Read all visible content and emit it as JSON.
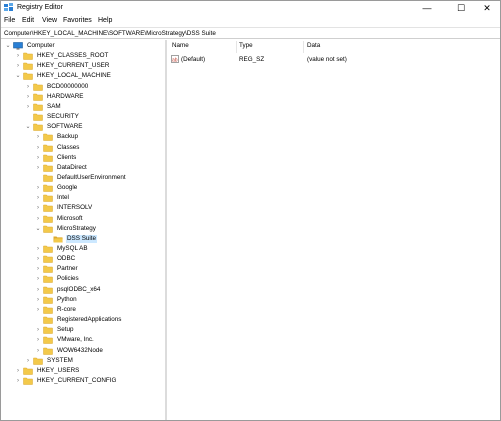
{
  "window": {
    "title": "Registry Editor"
  },
  "title_buttons": {
    "minimize": "—",
    "maximize": "☐",
    "close": "✕"
  },
  "menu": [
    "File",
    "Edit",
    "View",
    "Favorites",
    "Help"
  ],
  "address": "Computer\\HKEY_LOCAL_MACHINE\\SOFTWARE\\MicroStrategy\\DSS Suite",
  "tree": [
    {
      "label": "Computer",
      "level": 0,
      "expander": "⌄",
      "icon": "computer-icon"
    },
    {
      "label": "HKEY_CLASSES_ROOT",
      "level": 1,
      "expander": "›",
      "icon": "folder-icon"
    },
    {
      "label": "HKEY_CURRENT_USER",
      "level": 1,
      "expander": "›",
      "icon": "folder-icon"
    },
    {
      "label": "HKEY_LOCAL_MACHINE",
      "level": 1,
      "expander": "⌄",
      "icon": "folder-icon"
    },
    {
      "label": "BCD00000000",
      "level": 2,
      "expander": "›",
      "icon": "folder-icon"
    },
    {
      "label": "HARDWARE",
      "level": 2,
      "expander": "›",
      "icon": "folder-icon"
    },
    {
      "label": "SAM",
      "level": 2,
      "expander": "›",
      "icon": "folder-icon"
    },
    {
      "label": "SECURITY",
      "level": 2,
      "expander": "",
      "icon": "folder-icon"
    },
    {
      "label": "SOFTWARE",
      "level": 2,
      "expander": "⌄",
      "icon": "folder-icon"
    },
    {
      "label": "Backup",
      "level": 3,
      "expander": "›",
      "icon": "folder-icon"
    },
    {
      "label": "Classes",
      "level": 3,
      "expander": "›",
      "icon": "folder-icon"
    },
    {
      "label": "Clients",
      "level": 3,
      "expander": "›",
      "icon": "folder-icon"
    },
    {
      "label": "DataDirect",
      "level": 3,
      "expander": "›",
      "icon": "folder-icon"
    },
    {
      "label": "DefaultUserEnvironment",
      "level": 3,
      "expander": "",
      "icon": "folder-icon"
    },
    {
      "label": "Google",
      "level": 3,
      "expander": "›",
      "icon": "folder-icon"
    },
    {
      "label": "Intel",
      "level": 3,
      "expander": "›",
      "icon": "folder-icon"
    },
    {
      "label": "INTERSOLV",
      "level": 3,
      "expander": "›",
      "icon": "folder-icon"
    },
    {
      "label": "Microsoft",
      "level": 3,
      "expander": "›",
      "icon": "folder-icon"
    },
    {
      "label": "MicroStrategy",
      "level": 3,
      "expander": "⌄",
      "icon": "folder-icon"
    },
    {
      "label": "DSS Suite",
      "level": 4,
      "expander": "",
      "icon": "folder-open-icon",
      "selected": true
    },
    {
      "label": "MySQL AB",
      "level": 3,
      "expander": "›",
      "icon": "folder-icon"
    },
    {
      "label": "ODBC",
      "level": 3,
      "expander": "›",
      "icon": "folder-icon"
    },
    {
      "label": "Partner",
      "level": 3,
      "expander": "›",
      "icon": "folder-icon"
    },
    {
      "label": "Policies",
      "level": 3,
      "expander": "›",
      "icon": "folder-icon"
    },
    {
      "label": "psqlODBC_x64",
      "level": 3,
      "expander": "›",
      "icon": "folder-icon"
    },
    {
      "label": "Python",
      "level": 3,
      "expander": "›",
      "icon": "folder-icon"
    },
    {
      "label": "R-core",
      "level": 3,
      "expander": "›",
      "icon": "folder-icon"
    },
    {
      "label": "RegisteredApplications",
      "level": 3,
      "expander": "",
      "icon": "folder-icon"
    },
    {
      "label": "Setup",
      "level": 3,
      "expander": "›",
      "icon": "folder-icon"
    },
    {
      "label": "VMware, Inc.",
      "level": 3,
      "expander": "›",
      "icon": "folder-icon"
    },
    {
      "label": "WOW6432Node",
      "level": 3,
      "expander": "›",
      "icon": "folder-icon"
    },
    {
      "label": "SYSTEM",
      "level": 2,
      "expander": "›",
      "icon": "folder-icon"
    },
    {
      "label": "HKEY_USERS",
      "level": 1,
      "expander": "›",
      "icon": "folder-icon"
    },
    {
      "label": "HKEY_CURRENT_CONFIG",
      "level": 1,
      "expander": "›",
      "icon": "folder-icon"
    }
  ],
  "list": {
    "columns": [
      "Name",
      "Type",
      "Data"
    ],
    "rows": [
      {
        "name": "(Default)",
        "type": "REG_SZ",
        "data": "(value not set)",
        "icon": "string-value-icon"
      }
    ]
  },
  "colors": {
    "folder": "#f3c94a",
    "folder_dark": "#dca92e",
    "selection": "#cce8ff",
    "computer_icon": "#2a7fd4"
  }
}
